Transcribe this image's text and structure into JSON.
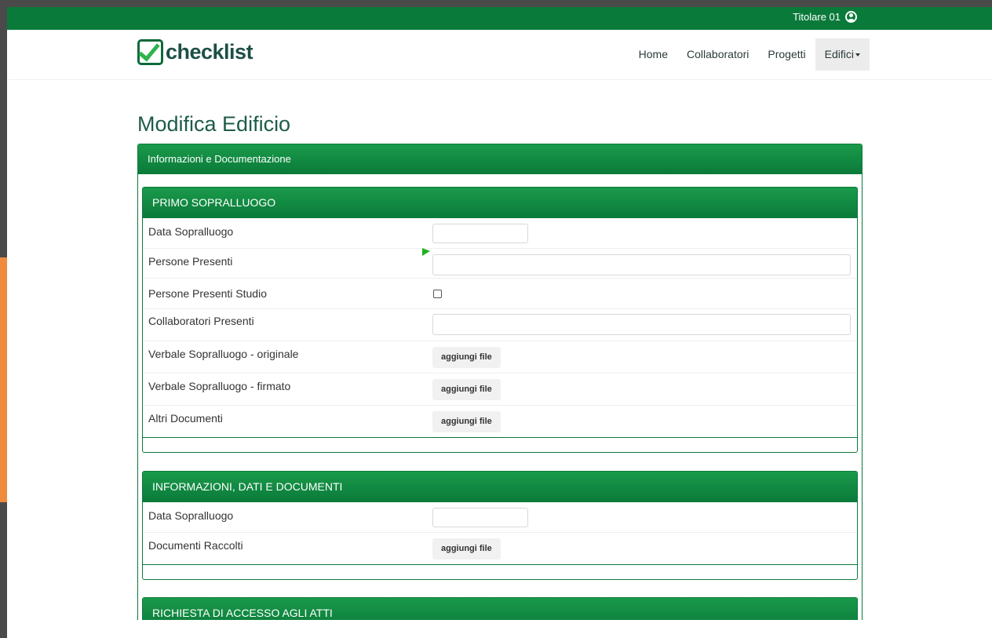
{
  "topbar": {
    "user_name": "Titolare 01",
    "user_icon": "user-circle-icon"
  },
  "logo": {
    "text": "checklist",
    "icon": "check-box-icon"
  },
  "nav": {
    "items": [
      {
        "label": "Home"
      },
      {
        "label": "Collaboratori"
      },
      {
        "label": "Progetti"
      },
      {
        "label": "Edifici",
        "active": true,
        "dropdown": true
      }
    ]
  },
  "page": {
    "title": "Modifica Edificio"
  },
  "panel": {
    "title": "Informazioni e Documentazione"
  },
  "sections": [
    {
      "title": "PRIMO SOPRALLUOGO",
      "rows": [
        {
          "label": "Data Sopralluogo",
          "type": "date",
          "value": ""
        },
        {
          "label": "Persone Presenti",
          "type": "text",
          "value": ""
        },
        {
          "label": "Persone Presenti Studio",
          "type": "checkbox",
          "checked": false
        },
        {
          "label": "Collaboratori Presenti",
          "type": "text",
          "value": ""
        },
        {
          "label": "Verbale Sopralluogo - originale",
          "type": "file",
          "button": "aggiungi file"
        },
        {
          "label": "Verbale Sopralluogo - firmato",
          "type": "file",
          "button": "aggiungi file"
        },
        {
          "label": "Altri Documenti",
          "type": "file",
          "button": "aggiungi file"
        }
      ]
    },
    {
      "title": "INFORMAZIONI, DATI E DOCUMENTI",
      "rows": [
        {
          "label": "Data Sopralluogo",
          "type": "date",
          "value": ""
        },
        {
          "label": "Documenti Raccolti",
          "type": "file",
          "button": "aggiungi file"
        }
      ]
    },
    {
      "title": "RICHIESTA DI ACCESSO AGLI ATTI",
      "rows": []
    }
  ],
  "colors": {
    "brand_green": "#0a7a3a",
    "title_green": "#1d5c4a",
    "side_accent": "#f08a3c"
  }
}
